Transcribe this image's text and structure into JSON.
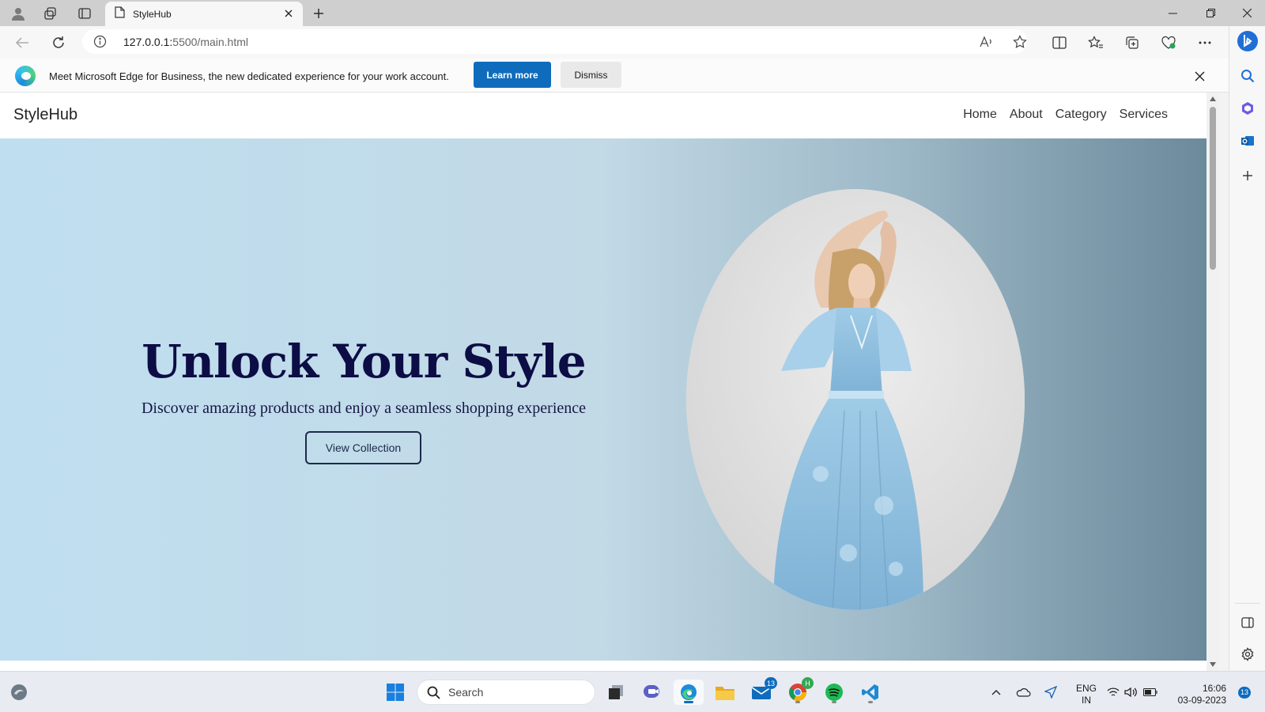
{
  "browser": {
    "tab_title": "StyleHub",
    "url_host": "127.0.0.1:",
    "url_path": "5500/main.html"
  },
  "infobar": {
    "message": "Meet Microsoft Edge for Business, the new dedicated experience for your work account.",
    "learn_more": "Learn more",
    "dismiss": "Dismiss"
  },
  "site": {
    "brand": "StyleHub",
    "nav": [
      "Home",
      "About",
      "Category",
      "Services"
    ],
    "hero_title": "Unlock Your Style",
    "hero_subtitle": "Discover amazing products and enjoy a seamless shopping experience",
    "cta": "View Collection"
  },
  "taskbar": {
    "search_placeholder": "Search",
    "mail_badge": "13",
    "chrome_badge": "H",
    "lang_line1": "ENG",
    "lang_line2": "IN",
    "time": "16:06",
    "date": "03-09-2023",
    "notifications": "13"
  },
  "colors": {
    "accent": "#0f6cbd",
    "hero_title": "#0d0d45",
    "hero_gradient_start": "#bfdff0",
    "hero_gradient_end": "#6b8a9b"
  }
}
